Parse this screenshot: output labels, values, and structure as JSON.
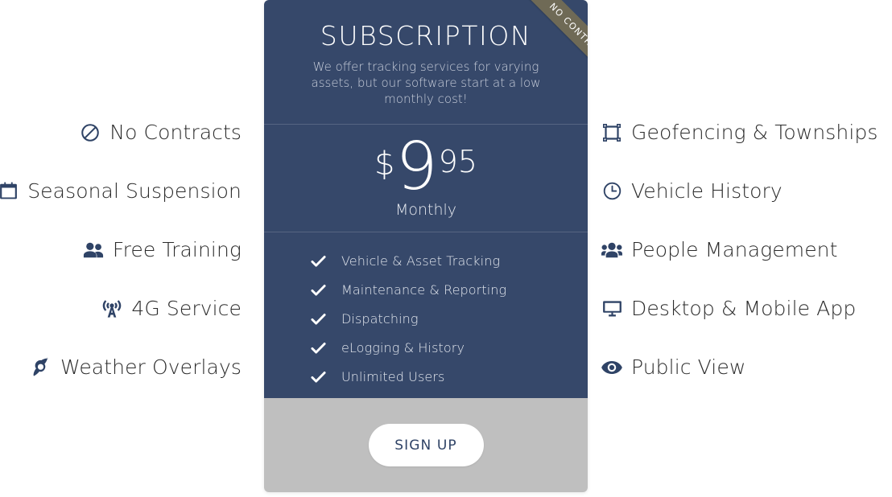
{
  "card": {
    "ribbon_label": "NO CONTRACT",
    "title": "SUBSCRIPTION",
    "subtitle": "We offer tracking services for varying assets, but our software start at a low monthly cost!",
    "price": {
      "currency": "$",
      "amount": "9",
      "cents": "95",
      "period": "Monthly"
    },
    "features": [
      {
        "icon": "check-icon",
        "label": "Vehicle & Asset Tracking"
      },
      {
        "icon": "check-icon",
        "label": "Maintenance & Reporting"
      },
      {
        "icon": "check-icon",
        "label": "Dispatching"
      },
      {
        "icon": "check-icon",
        "label": "eLogging & History"
      },
      {
        "icon": "check-icon",
        "label": "Unlimited Users"
      }
    ],
    "signup_label": "SIGN UP"
  },
  "left_features": [
    {
      "icon": "ban-icon",
      "label": "No Contracts"
    },
    {
      "icon": "calendar-x-icon",
      "label": "Seasonal Suspension"
    },
    {
      "icon": "user-friends-icon",
      "label": "Free Training"
    },
    {
      "icon": "broadcast-tower-icon",
      "label": "4G Service"
    },
    {
      "icon": "hurricane-icon",
      "label": "Weather Overlays"
    }
  ],
  "right_features": [
    {
      "icon": "vector-square-icon",
      "label": "Geofencing & Townships"
    },
    {
      "icon": "clock-icon",
      "label": "Vehicle History"
    },
    {
      "icon": "users-icon",
      "label": "People Management"
    },
    {
      "icon": "desktop-icon",
      "label": "Desktop & Mobile App"
    },
    {
      "icon": "eye-icon",
      "label": "Public View"
    }
  ],
  "colors": {
    "card_navy": "#36486a",
    "footer_gray": "#bfbfbf",
    "icon_navy": "#2f4366",
    "ribbon_olive": "#6f6a56",
    "page_bg": "#ffffff"
  }
}
